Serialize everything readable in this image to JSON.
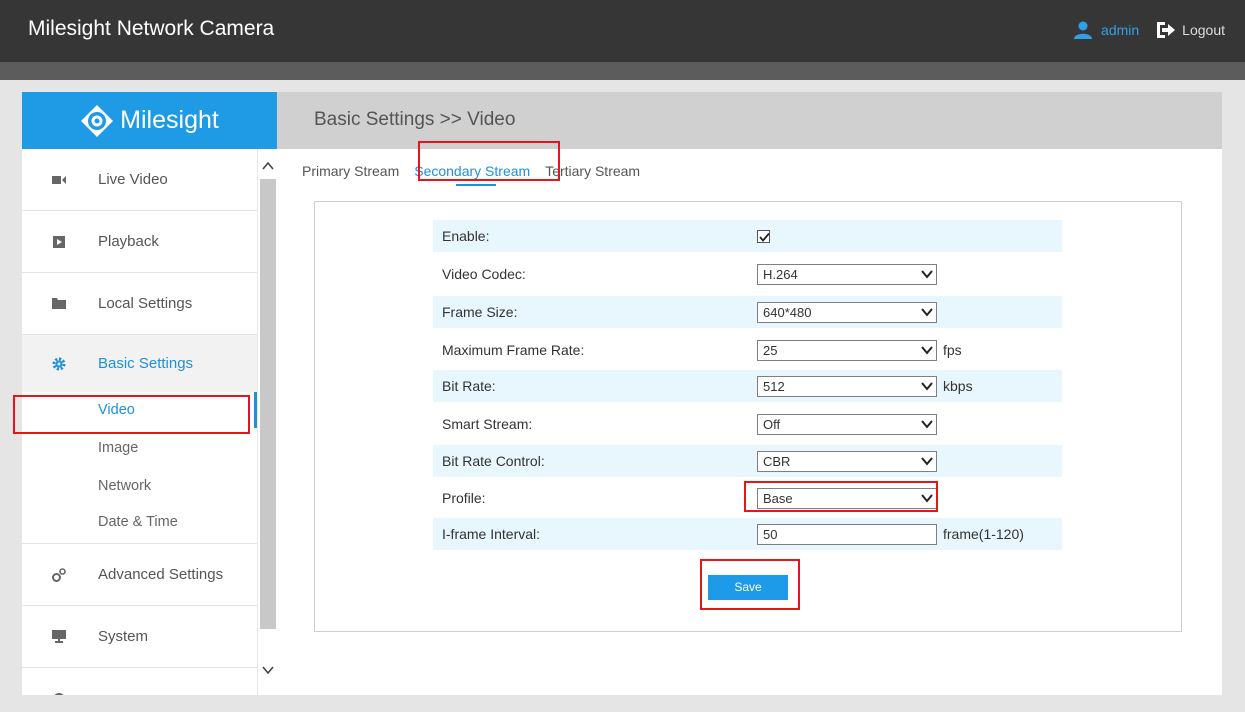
{
  "app": {
    "title": "Milesight Network Camera"
  },
  "user": {
    "name": "admin",
    "logout_label": "Logout"
  },
  "logo": {
    "text": "Milesight"
  },
  "sidebar": {
    "items": [
      {
        "label": "Live Video",
        "icon": "video-camera-icon"
      },
      {
        "label": "Playback",
        "icon": "playback-icon"
      },
      {
        "label": "Local Settings",
        "icon": "folder-icon"
      },
      {
        "label": "Basic Settings",
        "icon": "gear-icon"
      },
      {
        "label": "Advanced Settings",
        "icon": "gears-icon"
      },
      {
        "label": "System",
        "icon": "monitor-icon"
      }
    ],
    "submenu": [
      {
        "label": "Video"
      },
      {
        "label": "Image"
      },
      {
        "label": "Network"
      },
      {
        "label": "Date & Time"
      }
    ]
  },
  "header": {
    "title": "Basic Settings >> Video"
  },
  "tabs": [
    {
      "label": "Primary Stream"
    },
    {
      "label": "Secondary Stream"
    },
    {
      "label": "Tertiary Stream"
    }
  ],
  "form": {
    "enable": {
      "label": "Enable:",
      "checked": true
    },
    "video_codec": {
      "label": "Video Codec:",
      "value": "H.264"
    },
    "frame_size": {
      "label": "Frame Size:",
      "value": "640*480"
    },
    "max_frame_rate": {
      "label": "Maximum Frame Rate:",
      "value": "25",
      "unit": "fps"
    },
    "bit_rate": {
      "label": "Bit Rate:",
      "value": "512",
      "unit": "kbps"
    },
    "smart_stream": {
      "label": "Smart Stream:",
      "value": "Off"
    },
    "bit_rate_control": {
      "label": "Bit Rate Control:",
      "value": "CBR"
    },
    "profile": {
      "label": "Profile:",
      "value": "Base"
    },
    "iframe_interval": {
      "label": "I-frame Interval:",
      "value": "50",
      "unit": "frame(1-120)"
    }
  },
  "actions": {
    "save_label": "Save"
  },
  "colors": {
    "accent": "#1e9be8",
    "highlight": "#e8141b",
    "topbar": "#363636"
  }
}
